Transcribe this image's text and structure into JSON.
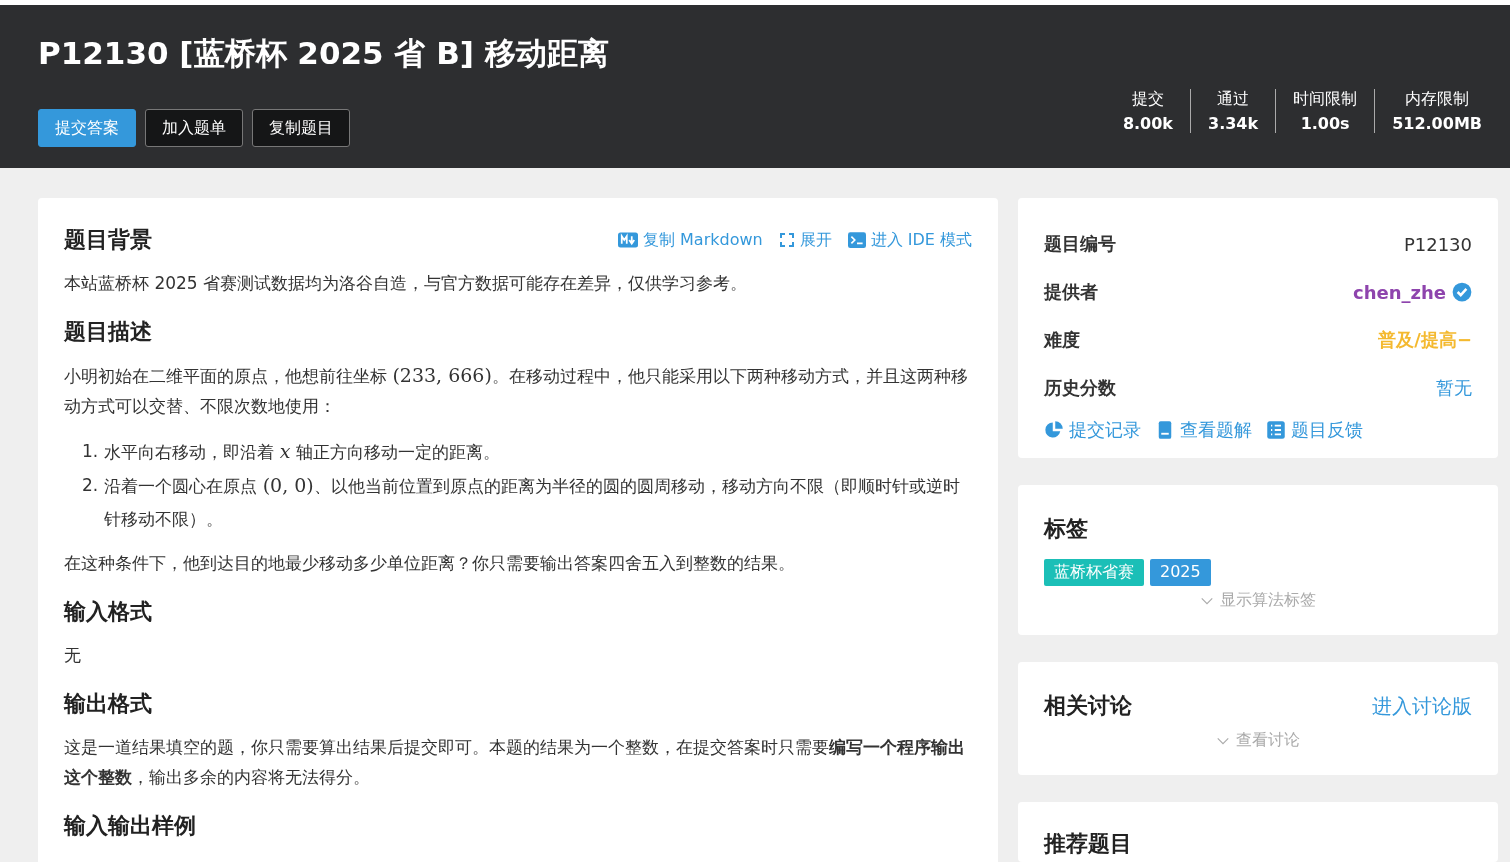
{
  "header": {
    "title": "P12130 [蓝桥杯 2025 省 B] 移动距离",
    "buttons": [
      {
        "label": "提交答案",
        "kind": "primary"
      },
      {
        "label": "加入题单",
        "kind": "dark"
      },
      {
        "label": "复制题目",
        "kind": "dark"
      }
    ],
    "stats": [
      {
        "label": "提交",
        "value": "8.00k"
      },
      {
        "label": "通过",
        "value": "3.34k"
      },
      {
        "label": "时间限制",
        "value": "1.00s"
      },
      {
        "label": "内存限制",
        "value": "512.00MB"
      }
    ]
  },
  "problem": {
    "actions": [
      {
        "label": "复制 Markdown",
        "kind": "markdown"
      },
      {
        "label": "展开",
        "kind": "expand"
      },
      {
        "label": "进入 IDE 模式",
        "kind": "terminal"
      }
    ],
    "sections": [
      {
        "title": "题目背景",
        "blocks": [
          {
            "kind": "paragraph",
            "parts": [
              {
                "kind": "text",
                "text": "本站蓝桥杯 2025 省赛测试数据均为洛谷自造，与官方数据可能存在差异，仅供学习参考。"
              }
            ]
          }
        ]
      },
      {
        "title": "题目描述",
        "blocks": [
          {
            "kind": "paragraph",
            "parts": [
              {
                "kind": "text",
                "text": "小明初始在二维平面的原点，他想前往坐标 "
              },
              {
                "kind": "math",
                "text": "(233, 666)"
              },
              {
                "kind": "text",
                "text": "。在移动过程中，他只能采用以下两种移动方式，并且这两种移动方式可以交替、不限次数地使用："
              }
            ]
          },
          {
            "kind": "list",
            "items": [
              {
                "marker": "1.",
                "parts": [
                  {
                    "kind": "text",
                    "text": "水平向右移动，即沿着 "
                  },
                  {
                    "kind": "math",
                    "text": "*x*"
                  },
                  {
                    "kind": "text",
                    "text": " 轴正方向移动一定的距离。"
                  }
                ]
              },
              {
                "marker": "2.",
                "parts": [
                  {
                    "kind": "text",
                    "text": "沿着一个圆心在原点 "
                  },
                  {
                    "kind": "math",
                    "text": "(0, 0)"
                  },
                  {
                    "kind": "text",
                    "text": "、以他当前位置到原点的距离为半径的圆的圆周移动，移动方向不限（即顺时针或逆时针移动不限）。"
                  }
                ]
              }
            ]
          },
          {
            "kind": "paragraph",
            "parts": [
              {
                "kind": "text",
                "text": "在这种条件下，他到达目的地最少移动多少单位距离？你只需要输出答案四舍五入到整数的结果。"
              }
            ]
          }
        ]
      },
      {
        "title": "输入格式",
        "blocks": [
          {
            "kind": "paragraph",
            "parts": [
              {
                "kind": "text",
                "text": "无"
              }
            ]
          }
        ]
      },
      {
        "title": "输出格式",
        "blocks": [
          {
            "kind": "paragraph",
            "parts": [
              {
                "kind": "text",
                "text": "这是一道结果填空的题，你只需要算出结果后提交即可。本题的结果为一个整数，在提交答案时只需要**编写一个程序输出这个整数**，输出多余的内容将无法得分。"
              }
            ]
          }
        ]
      },
      {
        "title": "输入输出样例"
      }
    ]
  },
  "info": {
    "rows": [
      {
        "label": "题目编号",
        "value": "P12130",
        "kind": "plain"
      },
      {
        "label": "提供者",
        "value": "chen_zhe",
        "kind": "user",
        "color": "#8e44ad",
        "verified": true
      },
      {
        "label": "难度",
        "value": "普及/提高−",
        "kind": "difficulty",
        "color": "#f4b92f"
      },
      {
        "label": "历史分数",
        "value": "暂无",
        "kind": "link"
      }
    ],
    "links": [
      {
        "label": "提交记录",
        "kind": "records"
      },
      {
        "label": "查看题解",
        "kind": "solutions"
      },
      {
        "label": "题目反馈",
        "kind": "feedback"
      }
    ]
  },
  "tags": {
    "title": "标签",
    "items": [
      {
        "label": "蓝桥杯省赛",
        "color": "#1bbfb7"
      },
      {
        "label": "2025",
        "color": "#3498db"
      }
    ],
    "toggle": "显示算法标签"
  },
  "discussion": {
    "title": "相关讨论",
    "link": "进入讨论版",
    "toggle": "查看讨论"
  },
  "recommend": {
    "title": "推荐题目"
  }
}
